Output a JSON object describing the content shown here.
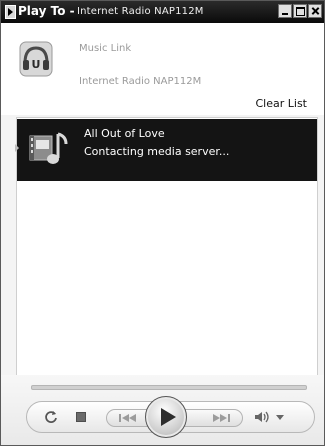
{
  "window": {
    "title": "Play To -",
    "device_name": "Internet Radio NAP112M"
  },
  "header": {
    "source_label": "Music Link",
    "device_label": "Internet Radio NAP112M",
    "clear_list_label": "Clear List"
  },
  "playlist": {
    "items": [
      {
        "title": "All Out of Love",
        "status": "Contacting media server..."
      }
    ]
  },
  "controls": {
    "seek_progress": 0,
    "icons": [
      "repeat-icon",
      "stop-icon",
      "previous-icon",
      "play-icon",
      "next-icon",
      "volume-icon",
      "volume-dropdown-icon"
    ]
  },
  "colors": {
    "titlebar": "#0a0a0a",
    "playlist_item_bg": "#141414",
    "text_muted": "#9a9a9a"
  }
}
